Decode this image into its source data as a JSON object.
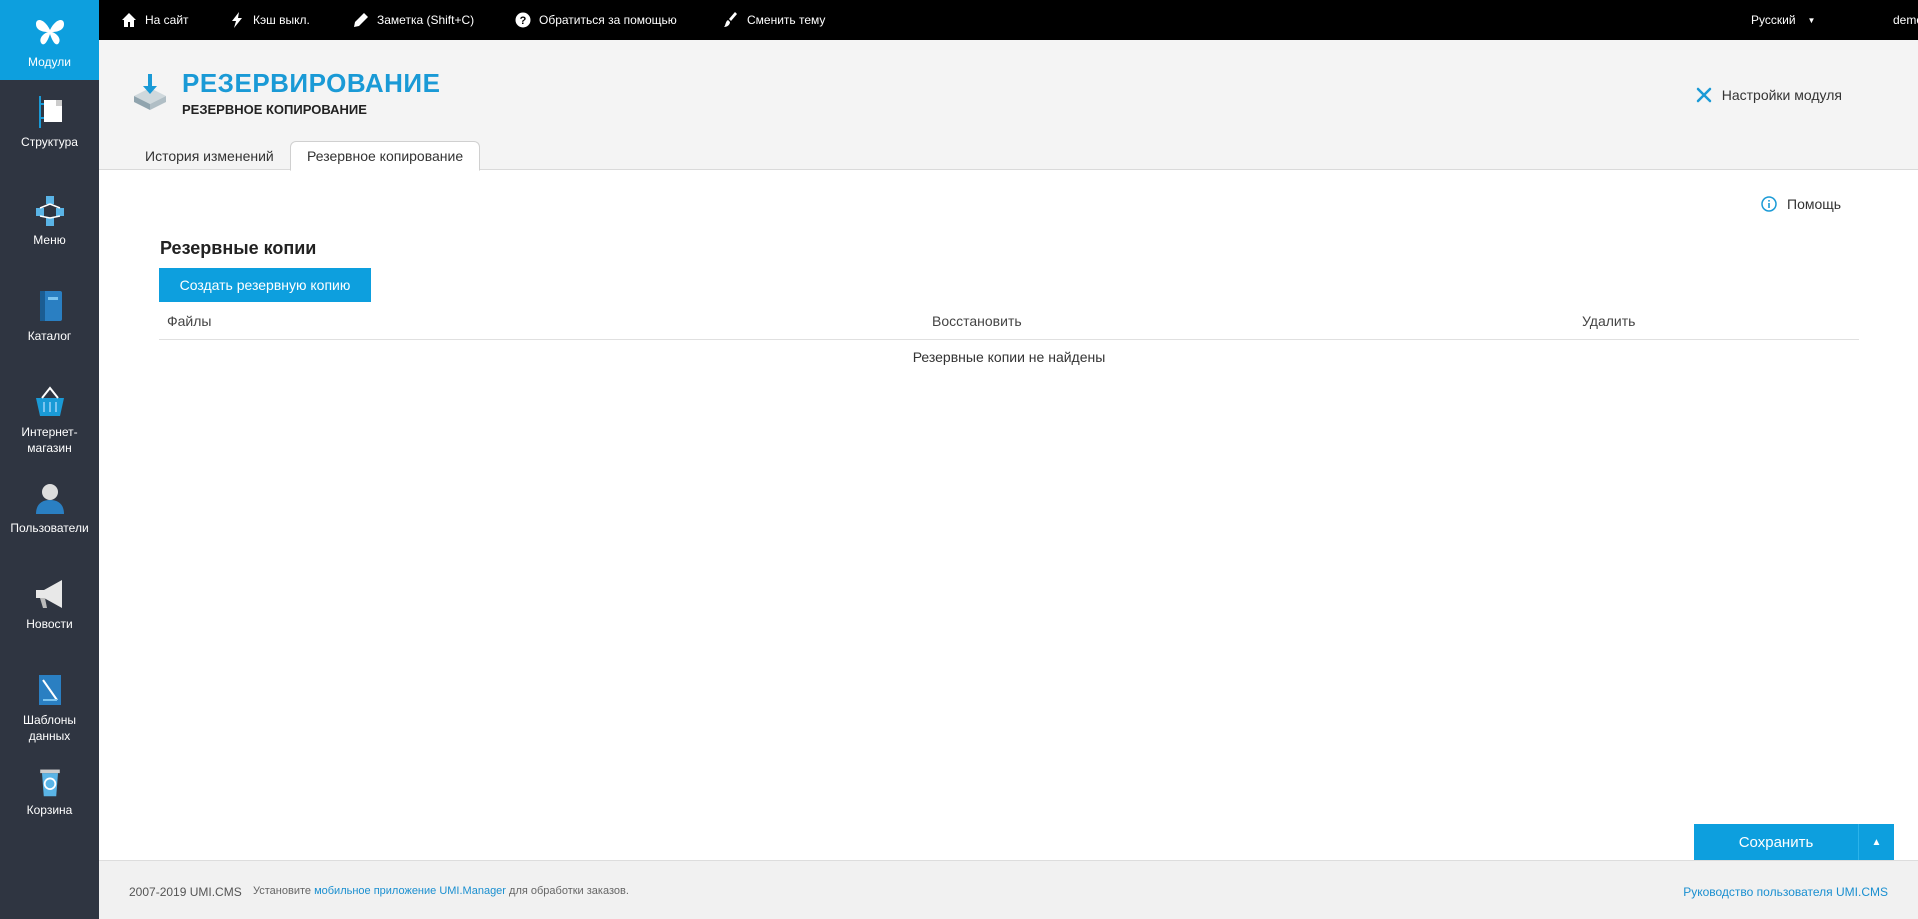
{
  "sidebar": {
    "items": [
      {
        "label": "Модули",
        "icon": "butterfly-icon",
        "active": true
      },
      {
        "label": "Структура",
        "icon": "structure-icon"
      },
      {
        "label": "Меню",
        "icon": "menu-tree-icon"
      },
      {
        "label": "Каталог",
        "icon": "catalog-book-icon"
      },
      {
        "label": "Интернет-\nмагазин",
        "icon": "shop-basket-icon"
      },
      {
        "label": "Пользователи",
        "icon": "user-icon"
      },
      {
        "label": "Новости",
        "icon": "megaphone-icon"
      },
      {
        "label": "Шаблоны\nданных",
        "icon": "data-template-icon"
      },
      {
        "label": "Корзина",
        "icon": "recycle-bin-icon"
      }
    ]
  },
  "topbar": {
    "site": "На сайт",
    "cache": "Кэш выкл.",
    "note": "Заметка (Shift+C)",
    "help": "Обратиться за помощью",
    "theme": "Сменить тему",
    "language": "Русский",
    "user": "demo"
  },
  "header": {
    "title": "РЕЗЕРВИРОВАНИЕ",
    "subtitle": "РЕЗЕРВНОЕ КОПИРОВАНИЕ",
    "settings": "Настройки модуля",
    "tabs": [
      {
        "label": "История изменений",
        "active": false
      },
      {
        "label": "Резервное копирование",
        "active": true
      }
    ]
  },
  "main": {
    "help": "Помощь",
    "section_title": "Резервные копии",
    "create_button": "Создать резервную копию",
    "columns": [
      "Файлы",
      "Восстановить",
      "Удалить"
    ],
    "empty_message": "Резервные копии не найдены"
  },
  "actions": {
    "save": "Сохранить"
  },
  "footer": {
    "copyright": "2007-2019 UMI.CMS",
    "install_prefix": "Установите ",
    "install_link": "мобильное приложение UMI.Manager",
    "install_suffix": " для обработки заказов.",
    "manual_link": "Руководство пользователя UMI.CMS"
  },
  "colors": {
    "accent": "#0d9fde",
    "sidebar": "#2f3541",
    "topbar": "#000000"
  }
}
